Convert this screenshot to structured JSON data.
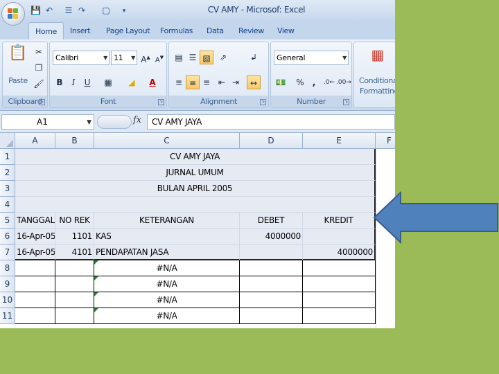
{
  "app": {
    "title": "CV AMY - Microsof: Excel"
  },
  "tabs": [
    "Home",
    "Insert",
    "Page Layout",
    "Formulas",
    "Data",
    "Review",
    "View"
  ],
  "ribbon": {
    "clipboard": {
      "label": "Clipboard",
      "paste": "Paste"
    },
    "font": {
      "label": "Font",
      "name": "Calibri",
      "size": "11",
      "bold": "B",
      "italic": "I",
      "underline": "U"
    },
    "alignment": {
      "label": "Alignment"
    },
    "number": {
      "label": "Number",
      "format": "General",
      "percent": "%",
      "comma": ","
    },
    "styles": {
      "conditional_line1": "Conditional",
      "conditional_line2": "Formatting"
    }
  },
  "formula_bar": {
    "cell_ref": "A1",
    "fx": "fx",
    "value": "CV AMY JAYA"
  },
  "columns": [
    "A",
    "B",
    "C",
    "D",
    "E",
    "F"
  ],
  "rows": [
    "1",
    "2",
    "3",
    "4",
    "5",
    "6",
    "7",
    "8",
    "9",
    "10",
    "11"
  ],
  "sheet": {
    "title1": "CV AMY JAYA",
    "title2": "JURNAL UMUM",
    "title3": "BULAN APRIL 2005",
    "headers": {
      "tanggal": "TANGGAL",
      "norek": "NO REK",
      "keterangan": "KETERANGAN",
      "debet": "DEBET",
      "kredit": "KREDIT"
    },
    "entries": [
      {
        "tanggal": "16-Apr-05",
        "norek": "1101",
        "keterangan": "KAS",
        "debet": "4000000",
        "kredit": ""
      },
      {
        "tanggal": "16-Apr-05",
        "norek": "4101",
        "keterangan": "PENDAPATAN JASA",
        "debet": "",
        "kredit": "4000000"
      }
    ],
    "errors": [
      "#N/A",
      "#N/A",
      "#N/A",
      "#N/A"
    ]
  },
  "colors": {
    "slide_background": "#9bbb59",
    "arrow_fill": "#4f81bd",
    "selection": "#e6eaf3"
  }
}
